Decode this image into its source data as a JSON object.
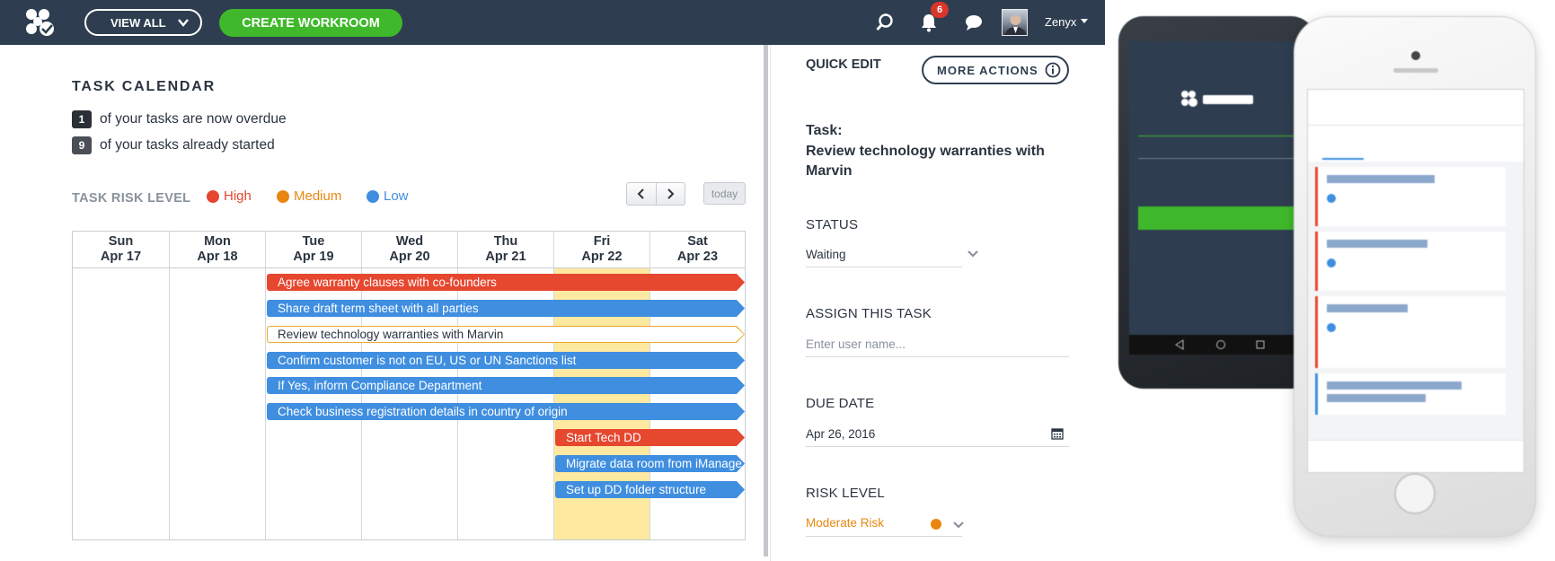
{
  "topbar": {
    "view_all_label": "VIEW ALL",
    "create_workroom_label": "CREATE WORKROOM",
    "notification_count": "6",
    "user_name": "Zenyx"
  },
  "calendar": {
    "title": "TASK CALENDAR",
    "overdue_count": "1",
    "overdue_text": "of your tasks are now overdue",
    "started_count": "9",
    "started_text": "of your tasks already started",
    "risk_label": "TASK RISK LEVEL",
    "legend": [
      {
        "label": "High",
        "color": "#e6472f"
      },
      {
        "label": "Medium",
        "color": "#e8870f"
      },
      {
        "label": "Low",
        "color": "#3f8ee0"
      }
    ],
    "today_label": "today",
    "days": [
      {
        "day": "Sun",
        "date": "Apr 17"
      },
      {
        "day": "Mon",
        "date": "Apr 18"
      },
      {
        "day": "Tue",
        "date": "Apr 19"
      },
      {
        "day": "Wed",
        "date": "Apr 20"
      },
      {
        "day": "Thu",
        "date": "Apr 21"
      },
      {
        "day": "Fri",
        "date": "Apr 22"
      },
      {
        "day": "Sat",
        "date": "Apr 23"
      }
    ],
    "events": [
      {
        "label": "Agree warranty clauses with co-founders",
        "risk": "high"
      },
      {
        "label": "Share draft term sheet with all parties",
        "risk": "low"
      },
      {
        "label": "Review technology warranties with Marvin",
        "risk": "selected"
      },
      {
        "label": "Confirm customer is not on EU, US or UN Sanctions list",
        "risk": "low"
      },
      {
        "label": "If Yes, inform Compliance Department",
        "risk": "low"
      },
      {
        "label": "Check business registration details in country of origin",
        "risk": "low"
      },
      {
        "label": "Start Tech DD",
        "risk": "high"
      },
      {
        "label": "Migrate data room from iManage",
        "risk": "low"
      },
      {
        "label": "Set up DD folder structure",
        "risk": "low"
      }
    ]
  },
  "quick_edit": {
    "title": "QUICK EDIT",
    "more_actions_label": "MORE ACTIONS",
    "task_label": "Task:",
    "task_name": "Review technology warranties with Marvin",
    "status_label": "STATUS",
    "status_value": "Waiting",
    "assign_label": "ASSIGN THIS TASK",
    "assign_placeholder": "Enter user name...",
    "due_date_label": "DUE DATE",
    "due_date_value": "Apr 26, 2016",
    "risk_level_label": "RISK LEVEL",
    "risk_level_value": "Moderate Risk"
  },
  "colors": {
    "topbar": "#2e3e50",
    "create_button": "#3fb92b",
    "high": "#e6472f",
    "medium": "#e8870f",
    "low": "#3f8ee0",
    "today_column": "#fde99f"
  }
}
